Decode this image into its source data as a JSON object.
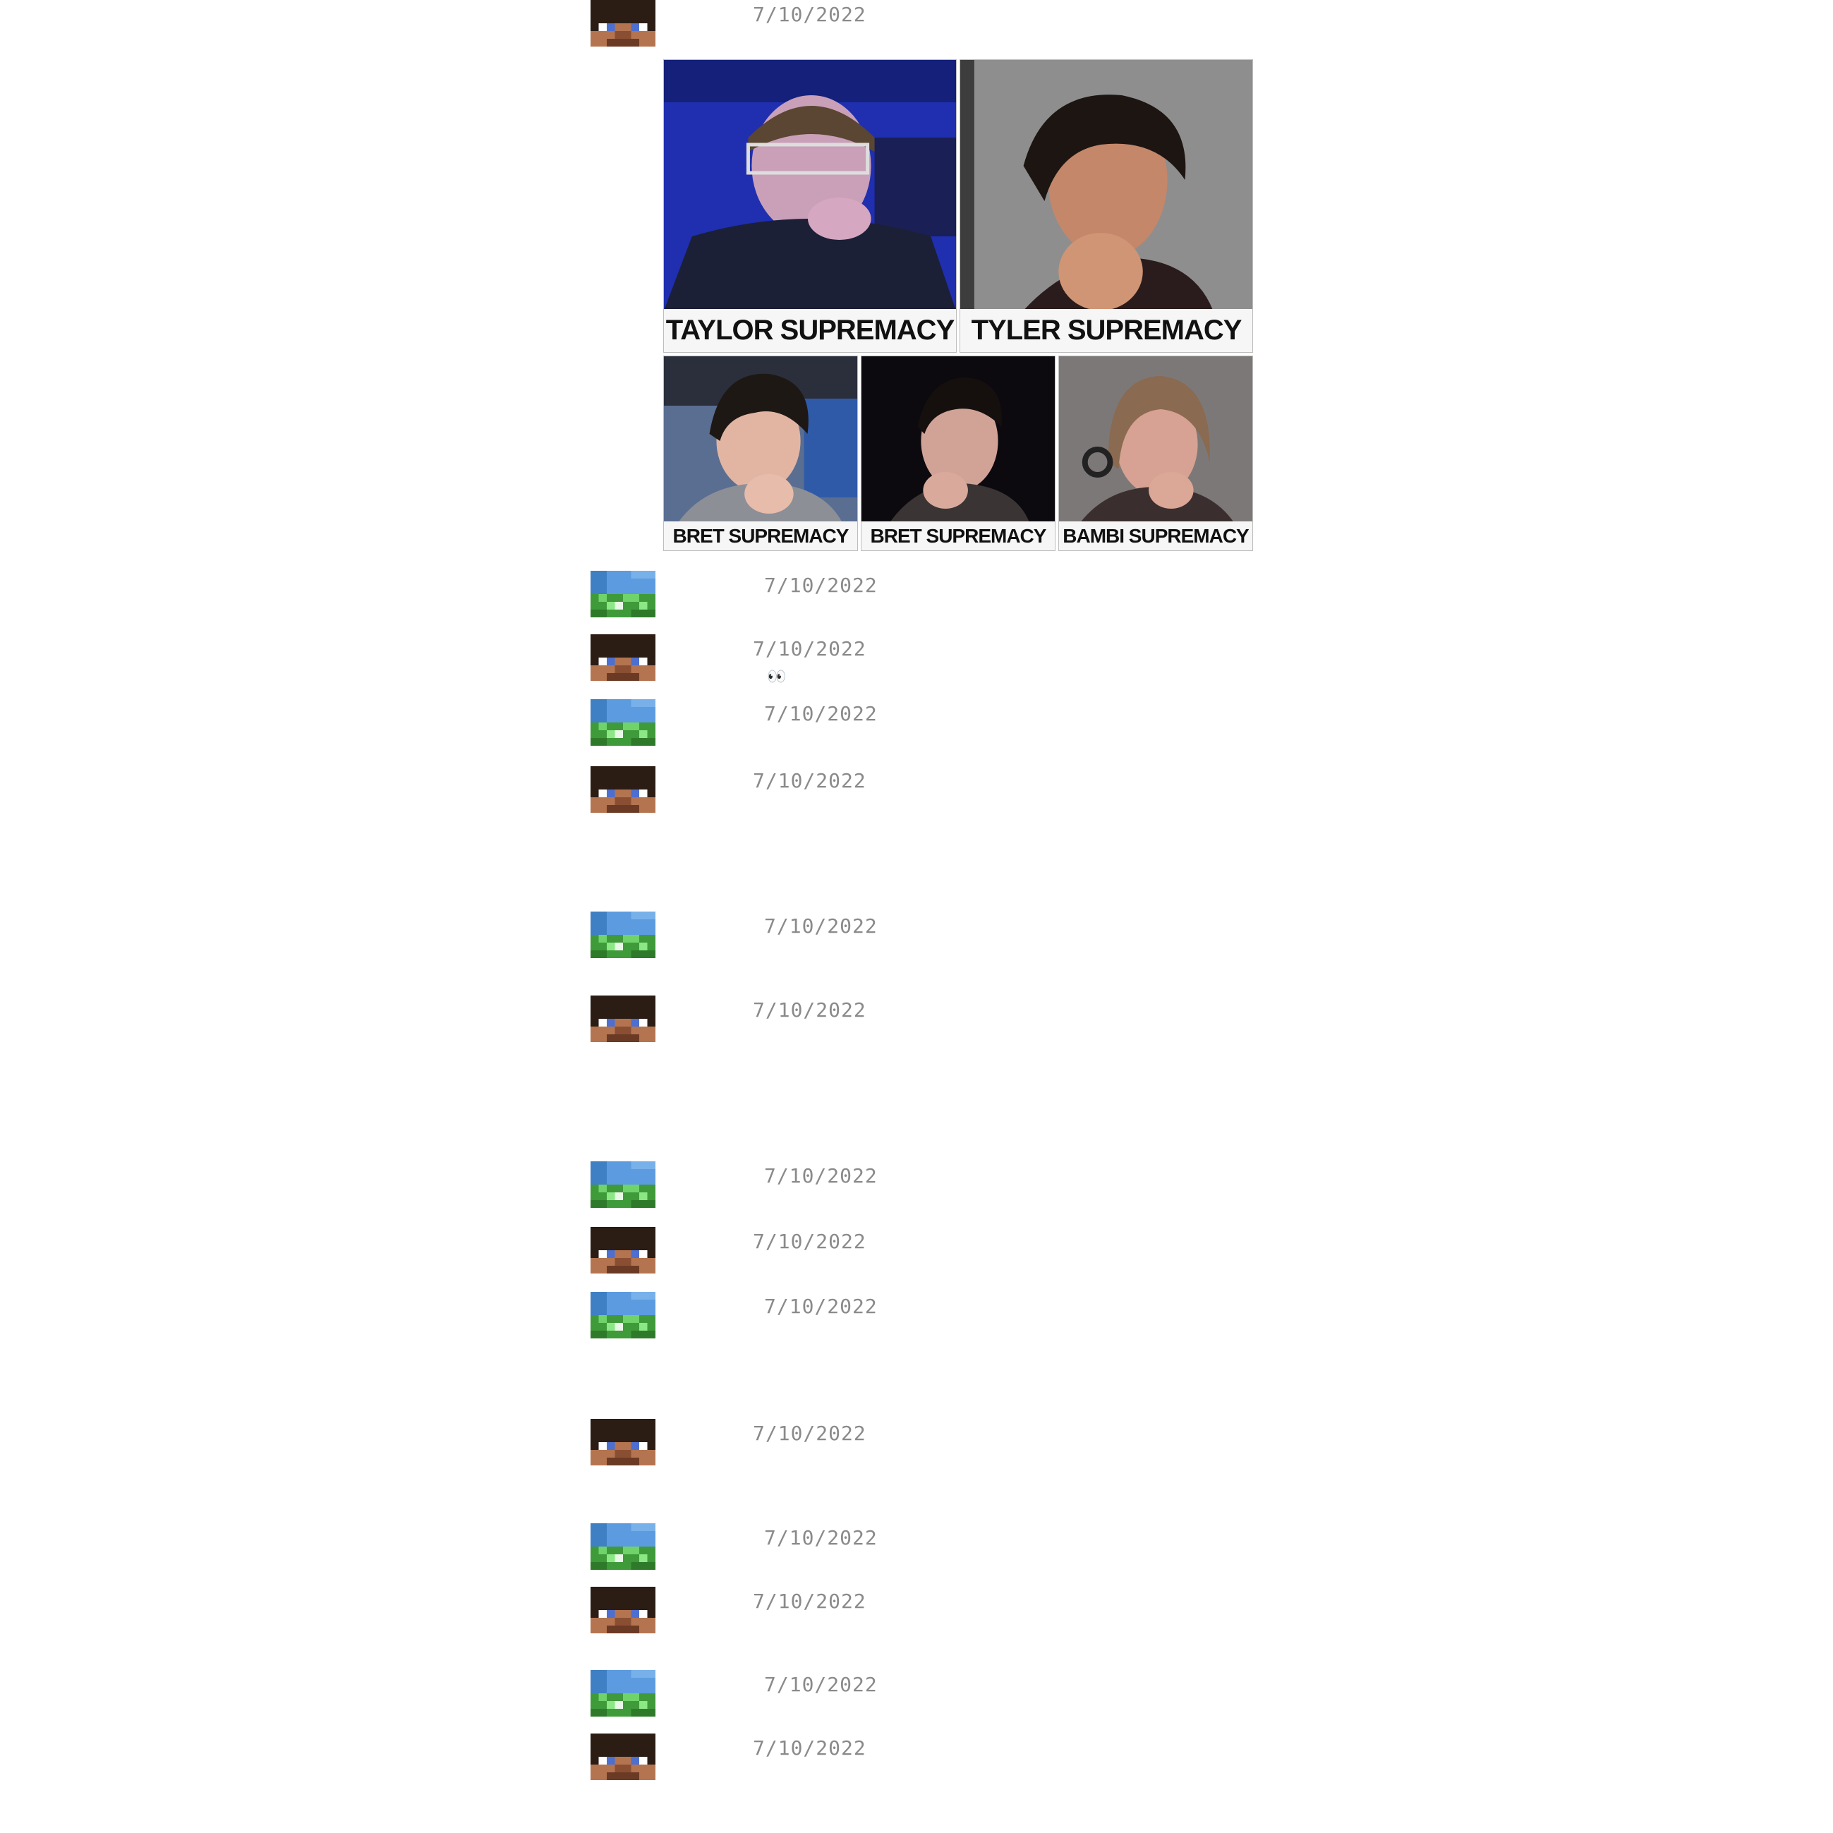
{
  "messages": [
    {
      "avatar": "steve-avatar",
      "timestamp": "7/10/2022",
      "reaction": ""
    },
    {
      "avatar": "grass-avatar",
      "timestamp": "7/10/2022",
      "reaction": ""
    },
    {
      "avatar": "steve-avatar",
      "timestamp": "7/10/2022",
      "reaction": "👀"
    },
    {
      "avatar": "grass-avatar",
      "timestamp": "7/10/2022",
      "reaction": ""
    },
    {
      "avatar": "steve-avatar",
      "timestamp": "7/10/2022",
      "reaction": ""
    },
    {
      "avatar": "grass-avatar",
      "timestamp": "7/10/2022",
      "reaction": ""
    },
    {
      "avatar": "steve-avatar",
      "timestamp": "7/10/2022",
      "reaction": ""
    },
    {
      "avatar": "grass-avatar",
      "timestamp": "7/10/2022",
      "reaction": ""
    },
    {
      "avatar": "steve-avatar",
      "timestamp": "7/10/2022",
      "reaction": ""
    },
    {
      "avatar": "grass-avatar",
      "timestamp": "7/10/2022",
      "reaction": ""
    },
    {
      "avatar": "steve-avatar",
      "timestamp": "7/10/2022",
      "reaction": ""
    },
    {
      "avatar": "grass-avatar",
      "timestamp": "7/10/2022",
      "reaction": ""
    },
    {
      "avatar": "steve-avatar",
      "timestamp": "7/10/2022",
      "reaction": ""
    },
    {
      "avatar": "grass-avatar",
      "timestamp": "7/10/2022",
      "reaction": ""
    },
    {
      "avatar": "steve-avatar",
      "timestamp": "7/10/2022",
      "reaction": ""
    }
  ],
  "attachment": {
    "captions": [
      "TAYLOR SUPREMACY",
      "TYLER SUPREMACY",
      "BRET SUPREMACY",
      "BRET SUPREMACY",
      "BAMBI SUPREMACY"
    ]
  },
  "colors": {
    "timestamp": "#8a8a8a",
    "background": "#ffffff"
  }
}
